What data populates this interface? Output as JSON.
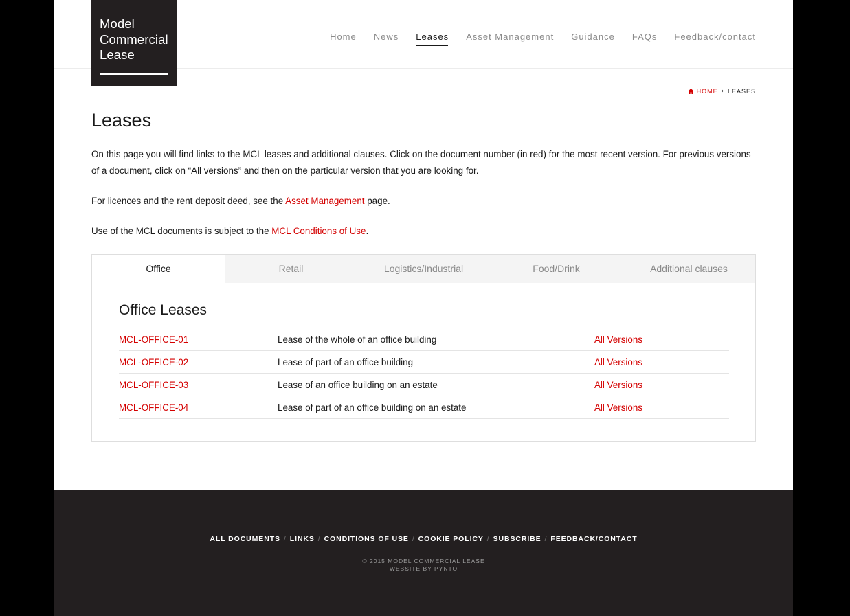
{
  "logo": {
    "lines": [
      "Model",
      "Commercial",
      "Lease"
    ]
  },
  "nav": {
    "items": [
      {
        "label": "Home"
      },
      {
        "label": "News"
      },
      {
        "label": "Leases"
      },
      {
        "label": "Asset Management"
      },
      {
        "label": "Guidance"
      },
      {
        "label": "FAQs"
      },
      {
        "label": "Feedback/contact"
      }
    ],
    "active": "Leases"
  },
  "breadcrumb": {
    "home": "HOME",
    "separator": "›",
    "current": "LEASES"
  },
  "page": {
    "title": "Leases",
    "intro": "On this page you will find links to the MCL leases and additional clauses. Click on the document number (in red) for the most recent version. For previous versions of a document, click on “All versions” and then on the particular version that you are looking for.",
    "licences_before": "For licences and the rent deposit deed, see the ",
    "licences_link": "Asset Management",
    "licences_after": " page.",
    "conditions_before": "Use of the MCL documents is subject to the ",
    "conditions_link": "MCL Conditions of Use",
    "conditions_after": "."
  },
  "tabs": [
    {
      "label": "Office"
    },
    {
      "label": "Retail"
    },
    {
      "label": "Logistics/Industrial"
    },
    {
      "label": "Food/Drink"
    },
    {
      "label": "Additional clauses"
    }
  ],
  "active_tab": "Office",
  "office": {
    "title": "Office Leases",
    "rows": [
      {
        "code": "MCL-OFFICE-01",
        "description": "Lease of the whole of an office building",
        "versions": "All Versions"
      },
      {
        "code": "MCL-OFFICE-02",
        "description": "Lease of part of an office building",
        "versions": "All Versions"
      },
      {
        "code": "MCL-OFFICE-03",
        "description": "Lease of an office building on an estate",
        "versions": "All Versions"
      },
      {
        "code": "MCL-OFFICE-04",
        "description": "Lease of part of an office building on an estate",
        "versions": "All Versions"
      }
    ]
  },
  "footer": {
    "links": [
      {
        "label": "ALL DOCUMENTS"
      },
      {
        "label": "LINKS"
      },
      {
        "label": "CONDITIONS OF USE"
      },
      {
        "label": "COOKIE POLICY"
      },
      {
        "label": "SUBSCRIBE"
      },
      {
        "label": "FEEDBACK/CONTACT"
      }
    ],
    "separator": "/",
    "copyright": "© 2015 MODEL COMMERCIAL LEASE",
    "credit": "WEBSITE BY PYNTO"
  },
  "colors": {
    "accent": "#d40000",
    "dark": "#231f20"
  },
  "icons": {
    "breadcrumb_home": "home-icon"
  }
}
